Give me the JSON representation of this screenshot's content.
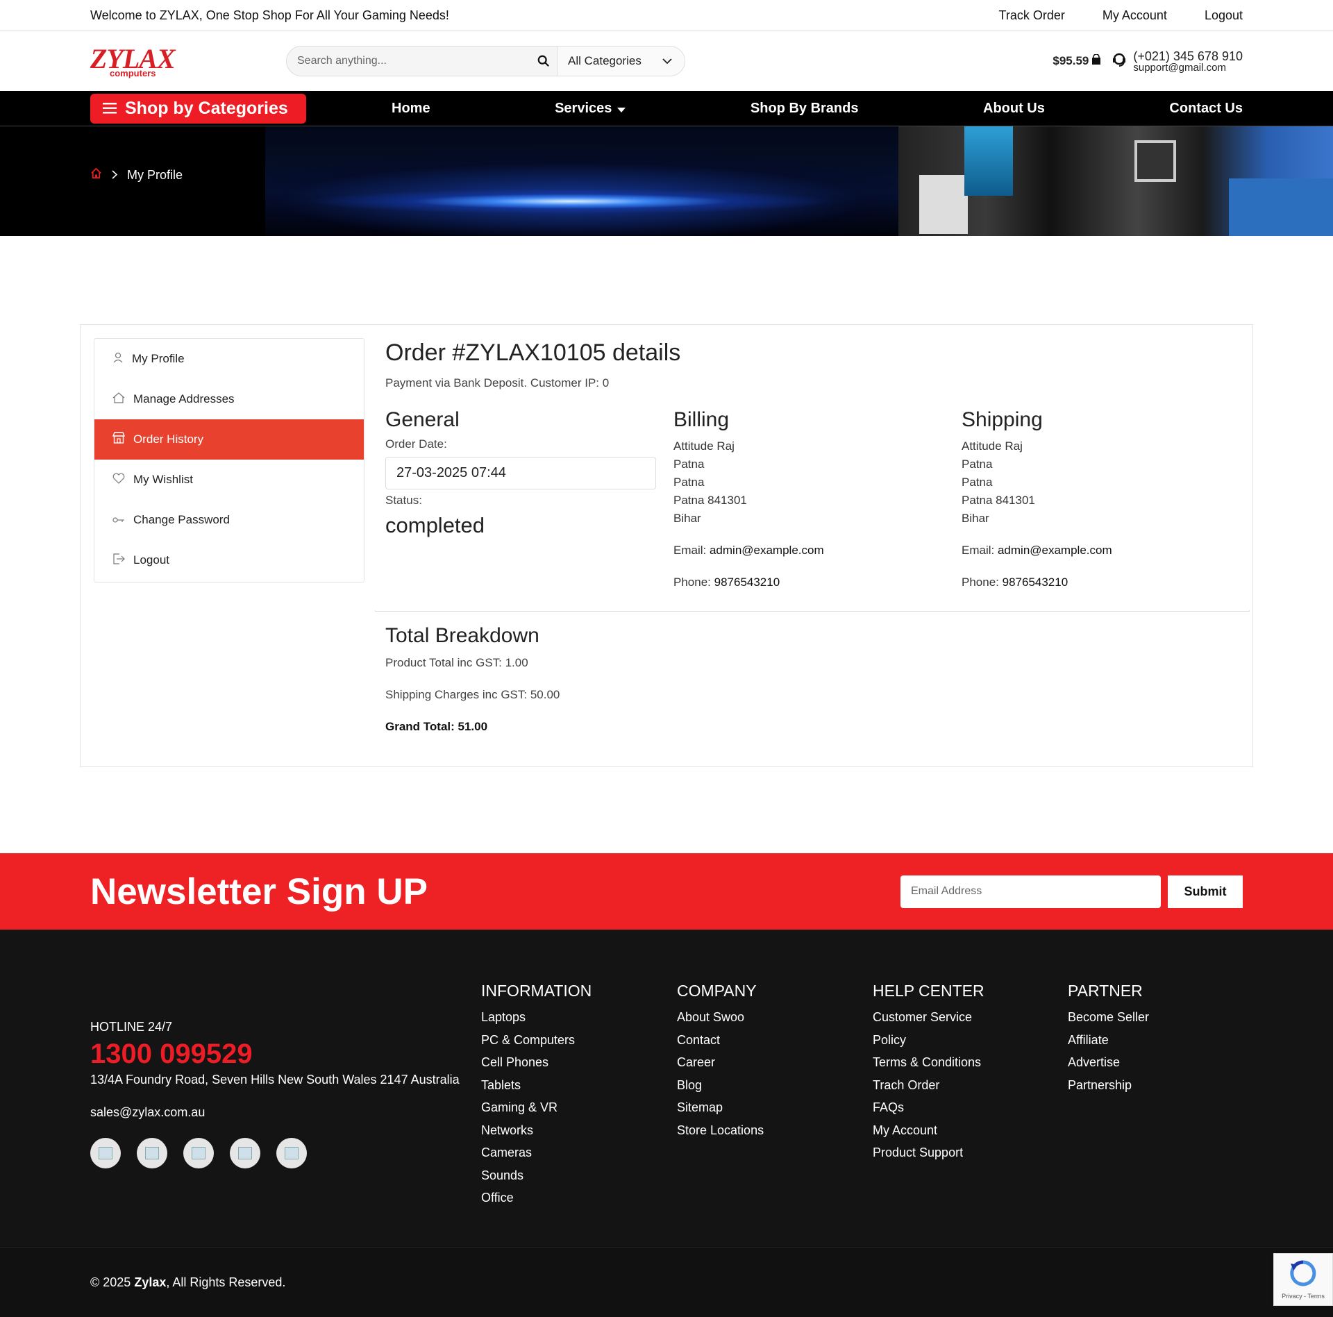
{
  "topbar": {
    "welcome": "Welcome to ZYLAX, One Stop Shop For All Your Gaming Needs!",
    "links": [
      "Track Order",
      "My Account",
      "Logout"
    ]
  },
  "header": {
    "logo_main": "ZYLAX",
    "logo_sub": "computers",
    "search_placeholder": "Search anything...",
    "category_select": "All Categories",
    "cart_total": "$95.59",
    "phone": "(+021) 345 678 910",
    "email": "support@gmail.com"
  },
  "nav": {
    "shop_by_categories": "Shop by Categories",
    "links": [
      "Home",
      "Services",
      "Shop By Brands",
      "About Us",
      "Contact Us"
    ]
  },
  "breadcrumb": {
    "current": "My Profile"
  },
  "sidebar": {
    "items": [
      {
        "label": "My Profile",
        "icon": "user-icon",
        "active": false
      },
      {
        "label": "Manage Addresses",
        "icon": "home-icon",
        "active": false
      },
      {
        "label": "Order History",
        "icon": "store-icon",
        "active": true
      },
      {
        "label": "My Wishlist",
        "icon": "heart-icon",
        "active": false
      },
      {
        "label": "Change Password",
        "icon": "key-icon",
        "active": false
      },
      {
        "label": "Logout",
        "icon": "logout-icon",
        "active": false
      }
    ]
  },
  "order": {
    "title": "Order #ZYLAX10105 details",
    "payment_line": "Payment via Bank Deposit. Customer IP: 0",
    "general": {
      "heading": "General",
      "order_date_label": "Order Date:",
      "order_date": "27-03-2025 07:44",
      "status_label": "Status:",
      "status": "completed"
    },
    "billing": {
      "heading": "Billing",
      "lines": [
        "Attitude Raj",
        "Patna",
        "Patna",
        "Patna 841301",
        "Bihar"
      ],
      "email_label": "Email:",
      "email": "admin@example.com",
      "phone_label": "Phone:",
      "phone": "9876543210"
    },
    "shipping": {
      "heading": "Shipping",
      "lines": [
        "Attitude Raj",
        "Patna",
        "Patna",
        "Patna 841301",
        "Bihar"
      ],
      "email_label": "Email:",
      "email": "admin@example.com",
      "phone_label": "Phone:",
      "phone": "9876543210"
    },
    "totals": {
      "heading": "Total Breakdown",
      "product_total": "Product Total inc GST: 1.00",
      "shipping": "Shipping Charges inc GST: 50.00",
      "grand": "Grand Total: 51.00"
    }
  },
  "newsletter": {
    "title": "Newsletter Sign UP",
    "email_placeholder": "Email Address",
    "submit": "Submit"
  },
  "footer": {
    "hotline_label": "HOTLINE 24/7",
    "hotline": "1300 099529",
    "address": "13/4A Foundry Road, Seven Hills New South Wales 2147 Australia",
    "email": "sales@zylax.com.au",
    "columns": [
      {
        "title": "INFORMATION",
        "items": [
          "Laptops",
          "PC & Computers",
          "Cell Phones",
          "Tablets",
          "Gaming & VR",
          "Networks",
          "Cameras",
          "Sounds",
          "Office"
        ]
      },
      {
        "title": "COMPANY",
        "items": [
          "About Swoo",
          "Contact",
          "Career",
          "Blog",
          "Sitemap",
          "Store Locations"
        ]
      },
      {
        "title": "HELP CENTER",
        "items": [
          "Customer Service",
          "Policy",
          "Terms & Conditions",
          "Trach Order",
          "FAQs",
          "My Account",
          "Product Support"
        ]
      },
      {
        "title": "PARTNER",
        "items": [
          "Become Seller",
          "Affiliate",
          "Advertise",
          "Partnership"
        ]
      }
    ],
    "copyright_prefix": "© 2025 ",
    "copyright_brand": "Zylax",
    "copyright_suffix": ", All Rights Reserved.",
    "recaptcha": "Privacy - Terms"
  },
  "colors": {
    "brand_red": "#ee1c25",
    "active_item": "#e8412e",
    "footer_bg": "#141414"
  }
}
